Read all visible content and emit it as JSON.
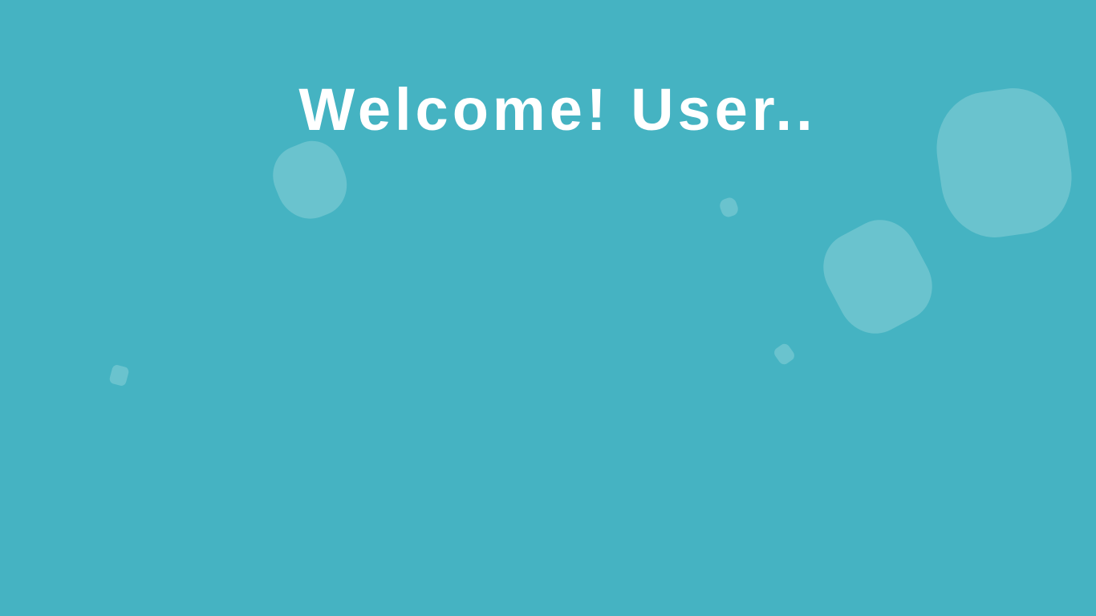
{
  "page": {
    "background_color": "#45b3c2",
    "bubble_color": "#6ac3ce",
    "title_color": "#ffffff"
  },
  "welcome": {
    "title": "Welcome! User.."
  }
}
